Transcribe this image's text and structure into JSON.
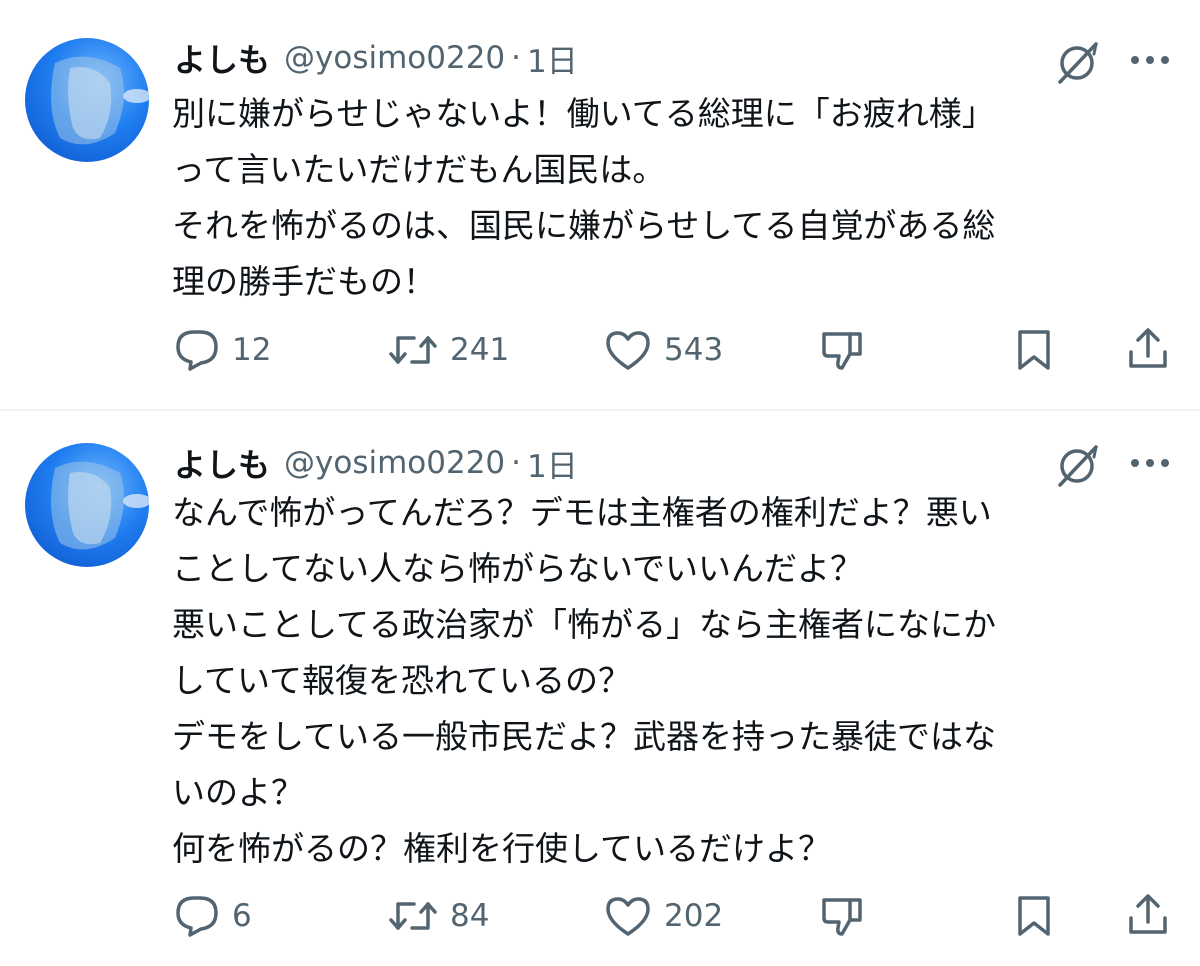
{
  "tweets": [
    {
      "name": "よしも",
      "handle": "@yosimo0220",
      "separator": "·",
      "time": "1日",
      "lines": [
        "別に嫌がらせじゃないよ！働いてる総理に「お疲れ様」",
        "って言いたいだけだもん国民は。",
        "それを怖がるのは、国民に嫌がらせしてる自覚がある総",
        "理の勝手だもの！"
      ],
      "replies": "12",
      "reposts": "241",
      "likes": "543"
    },
    {
      "name": "よしも",
      "handle": "@yosimo0220",
      "separator": "·",
      "time": "1日",
      "lines": [
        "なんで怖がってんだろ？デモは主権者の権利だよ？悪い",
        "ことしてない人なら怖がらないでいいんだよ？",
        "悪いことしてる政治家が「怖がる」なら主権者になにか",
        "していて報復を恐れているの？",
        "デモをしている一般市民だよ？武器を持った暴徒ではな",
        "いのよ？",
        "何を怖がるの？権利を行使しているだけよ？"
      ],
      "replies": "6",
      "reposts": "84",
      "likes": "202"
    }
  ],
  "icons": {
    "grok": "grok-icon",
    "more": "more-icon",
    "reply": "reply-icon",
    "repost": "repost-icon",
    "like": "heart-icon",
    "dislike": "thumbs-down-icon",
    "bookmark": "bookmark-icon",
    "share": "share-icon"
  },
  "colors": {
    "text": "#0f1419",
    "secondary": "#536471",
    "divider": "#eff3f4"
  }
}
